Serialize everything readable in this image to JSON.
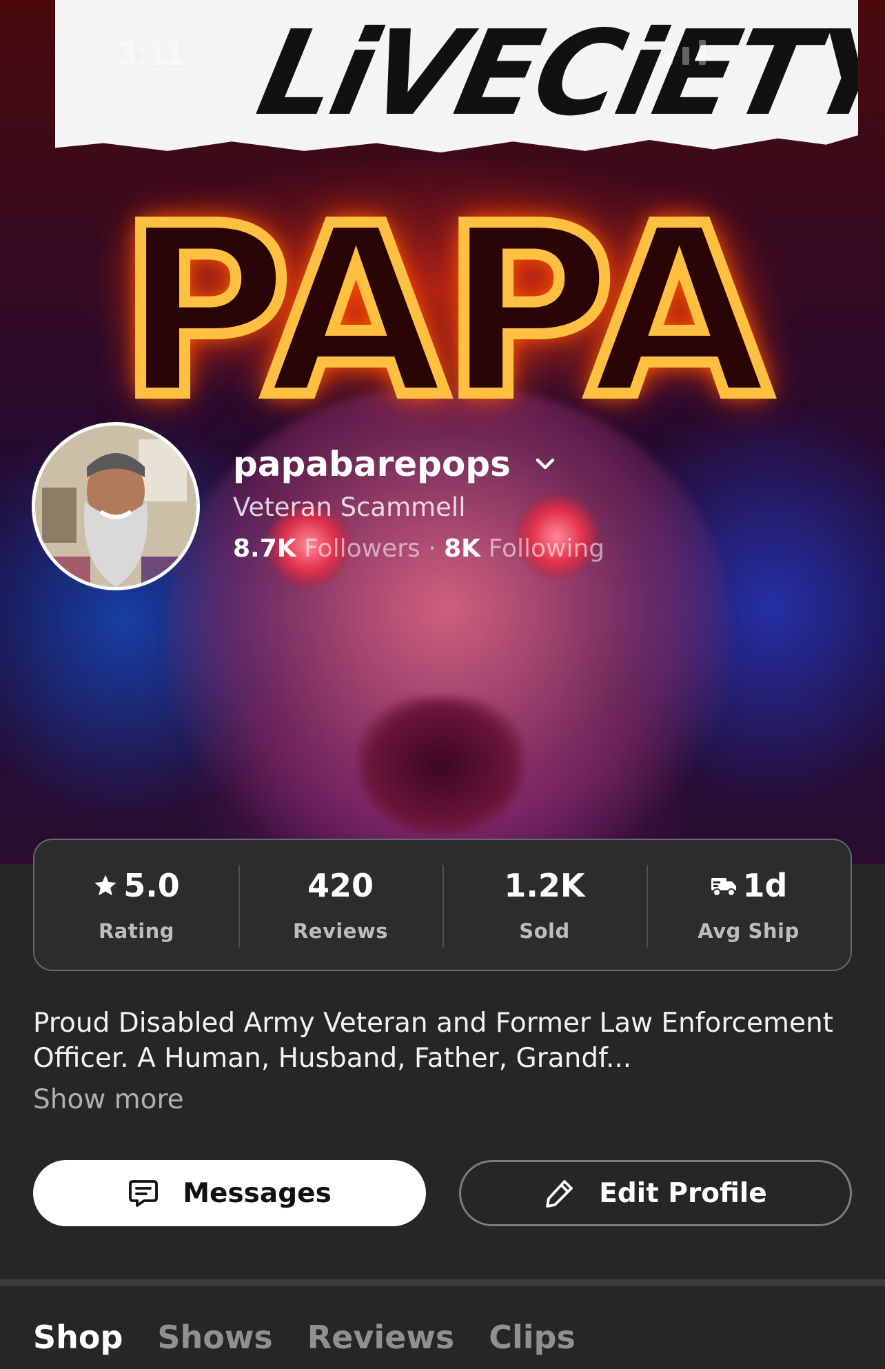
{
  "status_bar": {
    "time": "3:11"
  },
  "banner": {
    "logo_text": "LiVECiETY",
    "headline": "PAPA"
  },
  "profile": {
    "username": "papabarepops",
    "tagline": "Veteran Scammell",
    "followers_count": "8.7K",
    "followers_label": "Followers",
    "separator": "·",
    "following_count": "8K",
    "following_label": "Following"
  },
  "stats": [
    {
      "value": "5.0",
      "label": "Rating",
      "icon": "star-icon"
    },
    {
      "value": "420",
      "label": "Reviews",
      "icon": ""
    },
    {
      "value": "1.2K",
      "label": "Sold",
      "icon": ""
    },
    {
      "value": "1d",
      "label": "Avg Ship",
      "icon": "truck-icon"
    }
  ],
  "bio": {
    "text": "Proud Disabled Army Veteran and Former Law Enforcement Officer. A Human, Husband, Father, Grandf...",
    "show_more": "Show more"
  },
  "actions": {
    "messages_label": "Messages",
    "edit_profile_label": "Edit Profile"
  },
  "tabs": [
    {
      "label": "Shop",
      "active": true
    },
    {
      "label": "Shows",
      "active": false
    },
    {
      "label": "Reviews",
      "active": false
    },
    {
      "label": "Clips",
      "active": false
    }
  ],
  "colors": {
    "background": "#252627",
    "card": "#2b2c2e",
    "neon_orange": "#ffbf40",
    "muted_text": "#8f9092"
  }
}
